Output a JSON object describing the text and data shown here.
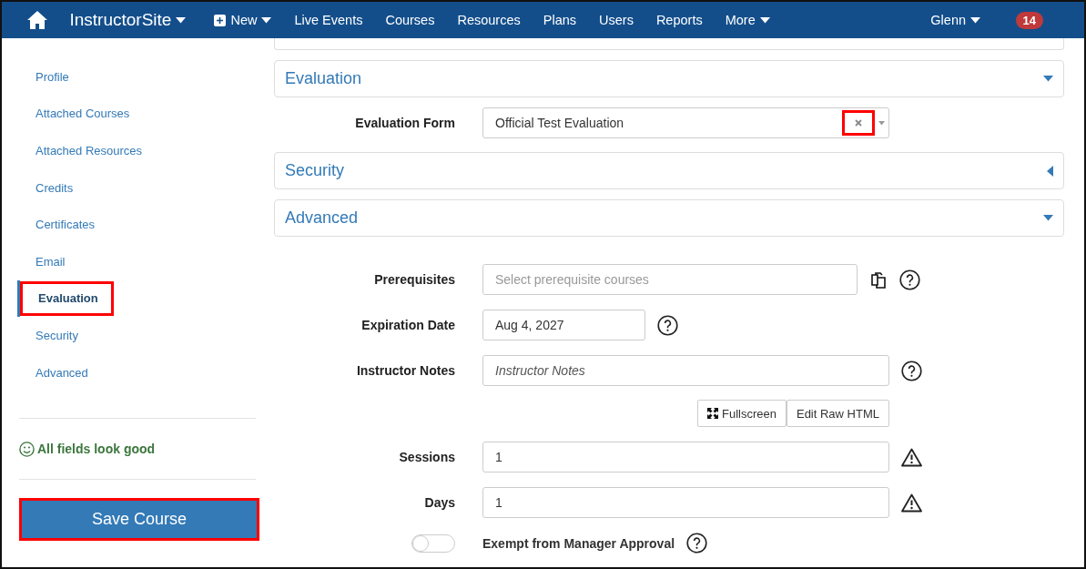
{
  "navbar": {
    "brand": "InstructorSite",
    "items": [
      {
        "label": "New",
        "kind": "new-menu"
      },
      {
        "label": "Live Events",
        "kind": "link"
      },
      {
        "label": "Courses",
        "kind": "link"
      },
      {
        "label": "Resources",
        "kind": "link"
      },
      {
        "label": "Plans",
        "kind": "link"
      },
      {
        "label": "Users",
        "kind": "link"
      },
      {
        "label": "Reports",
        "kind": "link"
      },
      {
        "label": "More",
        "kind": "menu"
      }
    ],
    "user": "Glenn",
    "notification_count": "14"
  },
  "sidebar": {
    "items": [
      {
        "label": "Profile",
        "selected": false,
        "highlighted": false
      },
      {
        "label": "Attached Courses",
        "selected": false,
        "highlighted": false
      },
      {
        "label": "Attached Resources",
        "selected": false,
        "highlighted": false
      },
      {
        "label": "Credits",
        "selected": false,
        "highlighted": false
      },
      {
        "label": "Certificates",
        "selected": false,
        "highlighted": false
      },
      {
        "label": "Email",
        "selected": false,
        "highlighted": false
      },
      {
        "label": "Evaluation",
        "selected": true,
        "highlighted": true
      },
      {
        "label": "Security",
        "selected": false,
        "highlighted": false
      },
      {
        "label": "Advanced",
        "selected": false,
        "highlighted": false
      }
    ],
    "status": "All fields look good",
    "save_button": {
      "label": "Save Course",
      "highlighted": true
    }
  },
  "sections": [
    {
      "title": "Evaluation",
      "expanded": true,
      "fields": [
        {
          "kind": "select",
          "label": "Evaluation Form",
          "value": "Official Test Evaluation",
          "clear_highlighted": true
        }
      ]
    },
    {
      "title": "Security",
      "expanded": false
    },
    {
      "title": "Advanced",
      "expanded": true,
      "fields": [
        {
          "kind": "multiselect",
          "label": "Prerequisites",
          "placeholder": "Select prerequisite courses",
          "help": true
        },
        {
          "kind": "date",
          "label": "Expiration Date",
          "value": "Aug 4, 2027",
          "help": true
        },
        {
          "kind": "editor",
          "label": "Instructor Notes",
          "placeholder": "Instructor Notes",
          "help": true,
          "buttons": [
            "Fullscreen",
            "Edit Raw HTML"
          ]
        },
        {
          "kind": "number",
          "label": "Sessions",
          "value": "1",
          "warning": true
        },
        {
          "kind": "number",
          "label": "Days",
          "value": "1",
          "warning": true
        },
        {
          "kind": "toggle",
          "label": "Exempt from Manager Approval",
          "on": false,
          "help": true
        }
      ]
    }
  ]
}
